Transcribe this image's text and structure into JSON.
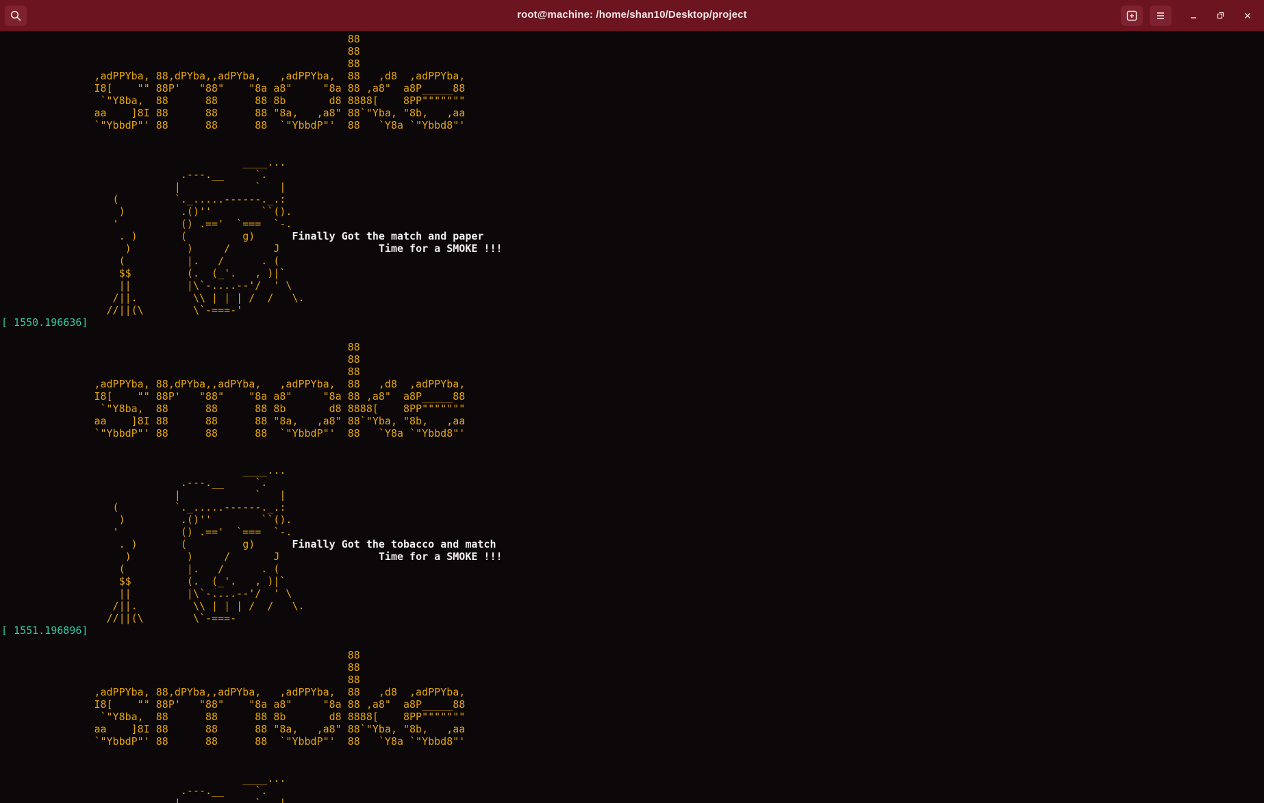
{
  "window": {
    "title": "root@machine: /home/shan10/Desktop/project"
  },
  "terminal": {
    "banner": [
      "                                                        88",
      "                                                        88",
      "                                                        88",
      "               ,adPPYba, 88,dPYba,,adPYba,   ,adPPYba,  88   ,d8  ,adPPYba,",
      "               I8[    \"\" 88P'   \"88\"    \"8a a8\"     \"8a 88 ,a8\"  a8P_____88",
      "                `\"Y8ba,  88      88      88 8b       d8 8888[    8PP\"\"\"\"\"\"\"",
      "               aa    ]8I 88      88      88 \"8a,   ,a8\" 88`\"Yba, \"8b,   ,aa",
      "               `\"YbbdP\"' 88      88      88  `\"YbbdP\"'  88   `Y8a `\"Ybbd8\"'"
    ],
    "blocks": [
      {
        "art": [
          "                                       ____...",
          "                             .---.__     `.",
          "                            |            `   |",
          "                  (         `._.....------._.:",
          "                   )         .()''        ``().",
          "                  '          () .=='  `===  `-.",
          "                   . )       (         g)      ",
          "                    )         )     /       J                ",
          "                   (          |.   /      . (",
          "                   $$         (.  (_'.   , )|`",
          "                   ||         |\\`-....--'/  ' \\",
          "                  /||.         \\\\ | | | /  /   \\.",
          "                 //||(\\        \\`-===-'"
        ],
        "message1": "Finally Got the match and paper",
        "message2": "Time for a SMOKE !!!",
        "timestamp": "[ 1550.196636]"
      },
      {
        "art": [
          "                                       ____...",
          "                             .---.__     `.",
          "                            |            `   |",
          "                  (         `._.....------._.:",
          "                   )         .()''        ``().",
          "                  '          () .=='  `===  `-.",
          "                   . )       (         g)      ",
          "                    )         )     /       J                ",
          "                   (          |.   /      . (",
          "                   $$         (.  (_'.   , )|`",
          "                   ||         |\\`-....--'/  ' \\",
          "                  /||.         \\\\ | | | /  /   \\.",
          "                 //||(\\        \\`-===-"
        ],
        "message1": "Finally Got the tobacco and match",
        "message2": "Time for a SMOKE !!!",
        "timestamp": "[ 1551.196896]"
      }
    ],
    "tail_art": [
      "                                       ____...",
      "                             .---.__     `.",
      "                            |            `   |"
    ]
  },
  "icons": {
    "search": "search-icon",
    "new_tab": "new-tab-icon",
    "menu": "hamburger-menu-icon",
    "minimize": "minimize-icon",
    "maximize": "maximize-icon",
    "close": "close-icon"
  },
  "colors": {
    "titlebar": "#6c1420",
    "background": "#0c0708",
    "ascii": "#e5a50a",
    "message": "#f0f0f0",
    "timestamp": "#33c7a5"
  }
}
